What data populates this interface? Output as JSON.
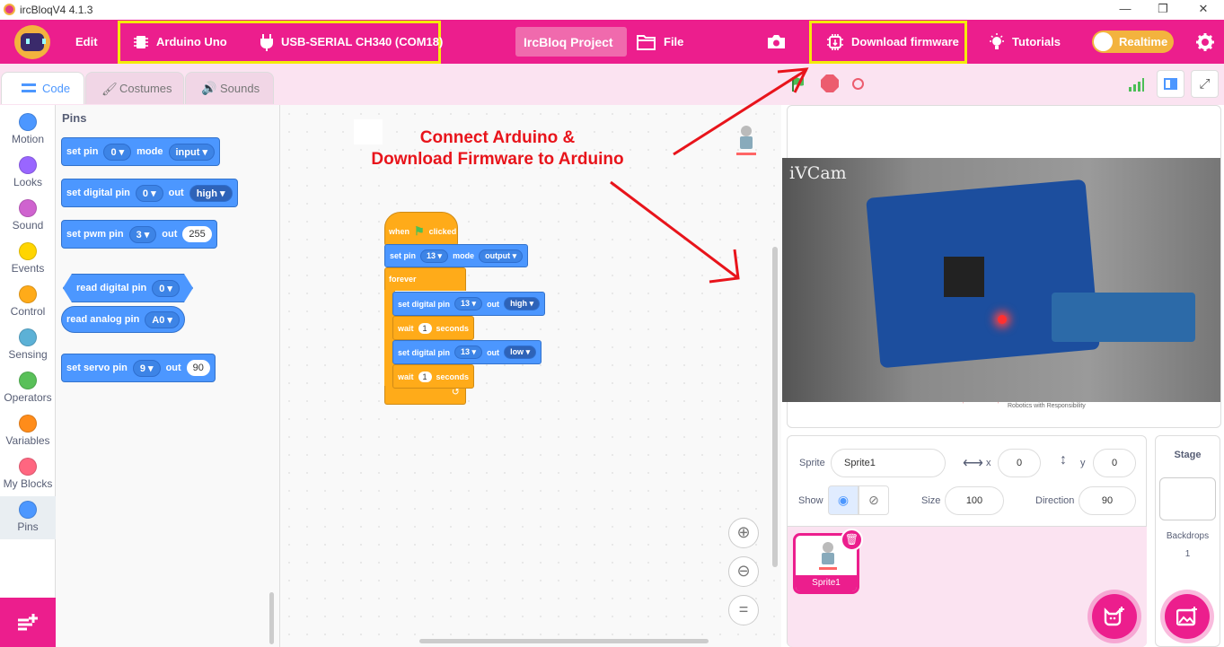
{
  "window": {
    "title": "ircBloqV4 4.1.3",
    "minimize": "—",
    "maximize": "❐",
    "close": "✕"
  },
  "menubar": {
    "edit": "Edit",
    "board": "Arduino Uno",
    "port": "USB-SERIAL CH340 (COM18)",
    "project_name": "IrcBloq Project",
    "file": "File",
    "download": "Download firmware",
    "tutorials": "Tutorials",
    "realtime": "Realtime"
  },
  "tabs": [
    {
      "label": "Code"
    },
    {
      "label": "Costumes"
    },
    {
      "label": "Sounds"
    }
  ],
  "categories": [
    {
      "label": "Motion",
      "color": "#4c97ff"
    },
    {
      "label": "Looks",
      "color": "#9966ff"
    },
    {
      "label": "Sound",
      "color": "#cf63cf"
    },
    {
      "label": "Events",
      "color": "#ffd500"
    },
    {
      "label": "Control",
      "color": "#ffab19"
    },
    {
      "label": "Sensing",
      "color": "#5cb1d6"
    },
    {
      "label": "Operators",
      "color": "#59c059"
    },
    {
      "label": "Variables",
      "color": "#ff8c1a"
    },
    {
      "label": "My Blocks",
      "color": "#ff6680"
    },
    {
      "label": "Pins",
      "color": "#4c97ff"
    }
  ],
  "palette": {
    "title": "Pins",
    "set_pin": {
      "label": "set pin",
      "pin": "0",
      "mode_label": "mode",
      "mode": "input"
    },
    "set_digital": {
      "label": "set digital pin",
      "pin": "0",
      "out_label": "out",
      "value": "high"
    },
    "set_pwm": {
      "label": "set pwm pin",
      "pin": "3",
      "out_label": "out",
      "value": "255"
    },
    "read_digital": {
      "label": "read digital pin",
      "pin": "0"
    },
    "read_analog": {
      "label": "read analog pin",
      "pin": "A0"
    },
    "set_servo": {
      "label": "set servo pin",
      "pin": "9",
      "out_label": "out",
      "value": "90"
    }
  },
  "annotation": {
    "line1": "Connect Arduino &",
    "line2": "Download Firmware to Arduino"
  },
  "script": {
    "hat": {
      "when": "when",
      "clicked": "clicked"
    },
    "setpin": {
      "label": "set pin",
      "pin": "13",
      "mode_label": "mode",
      "mode": "output"
    },
    "forever": "forever",
    "d1": {
      "label": "set digital pin",
      "pin": "13",
      "out_label": "out",
      "value": "high"
    },
    "w1": {
      "label": "wait",
      "value": "1",
      "unit": "seconds"
    },
    "d2": {
      "label": "set digital pin",
      "pin": "13",
      "out_label": "out",
      "value": "low"
    },
    "w2": {
      "label": "wait",
      "value": "1",
      "unit": "seconds"
    }
  },
  "stage": {
    "cam_label": "iVCam",
    "footer_text": "Robotics with Responsibility"
  },
  "sprite": {
    "sprite_label": "Sprite",
    "name": "Sprite1",
    "x_label": "x",
    "x": "0",
    "y_label": "y",
    "y": "0",
    "show_label": "Show",
    "size_label": "Size",
    "size": "100",
    "direction_label": "Direction",
    "direction": "90",
    "thumb_label": "Sprite1"
  },
  "stage_pane": {
    "title": "Stage",
    "backdrops_label": "Backdrops",
    "backdrops_count": "1"
  }
}
